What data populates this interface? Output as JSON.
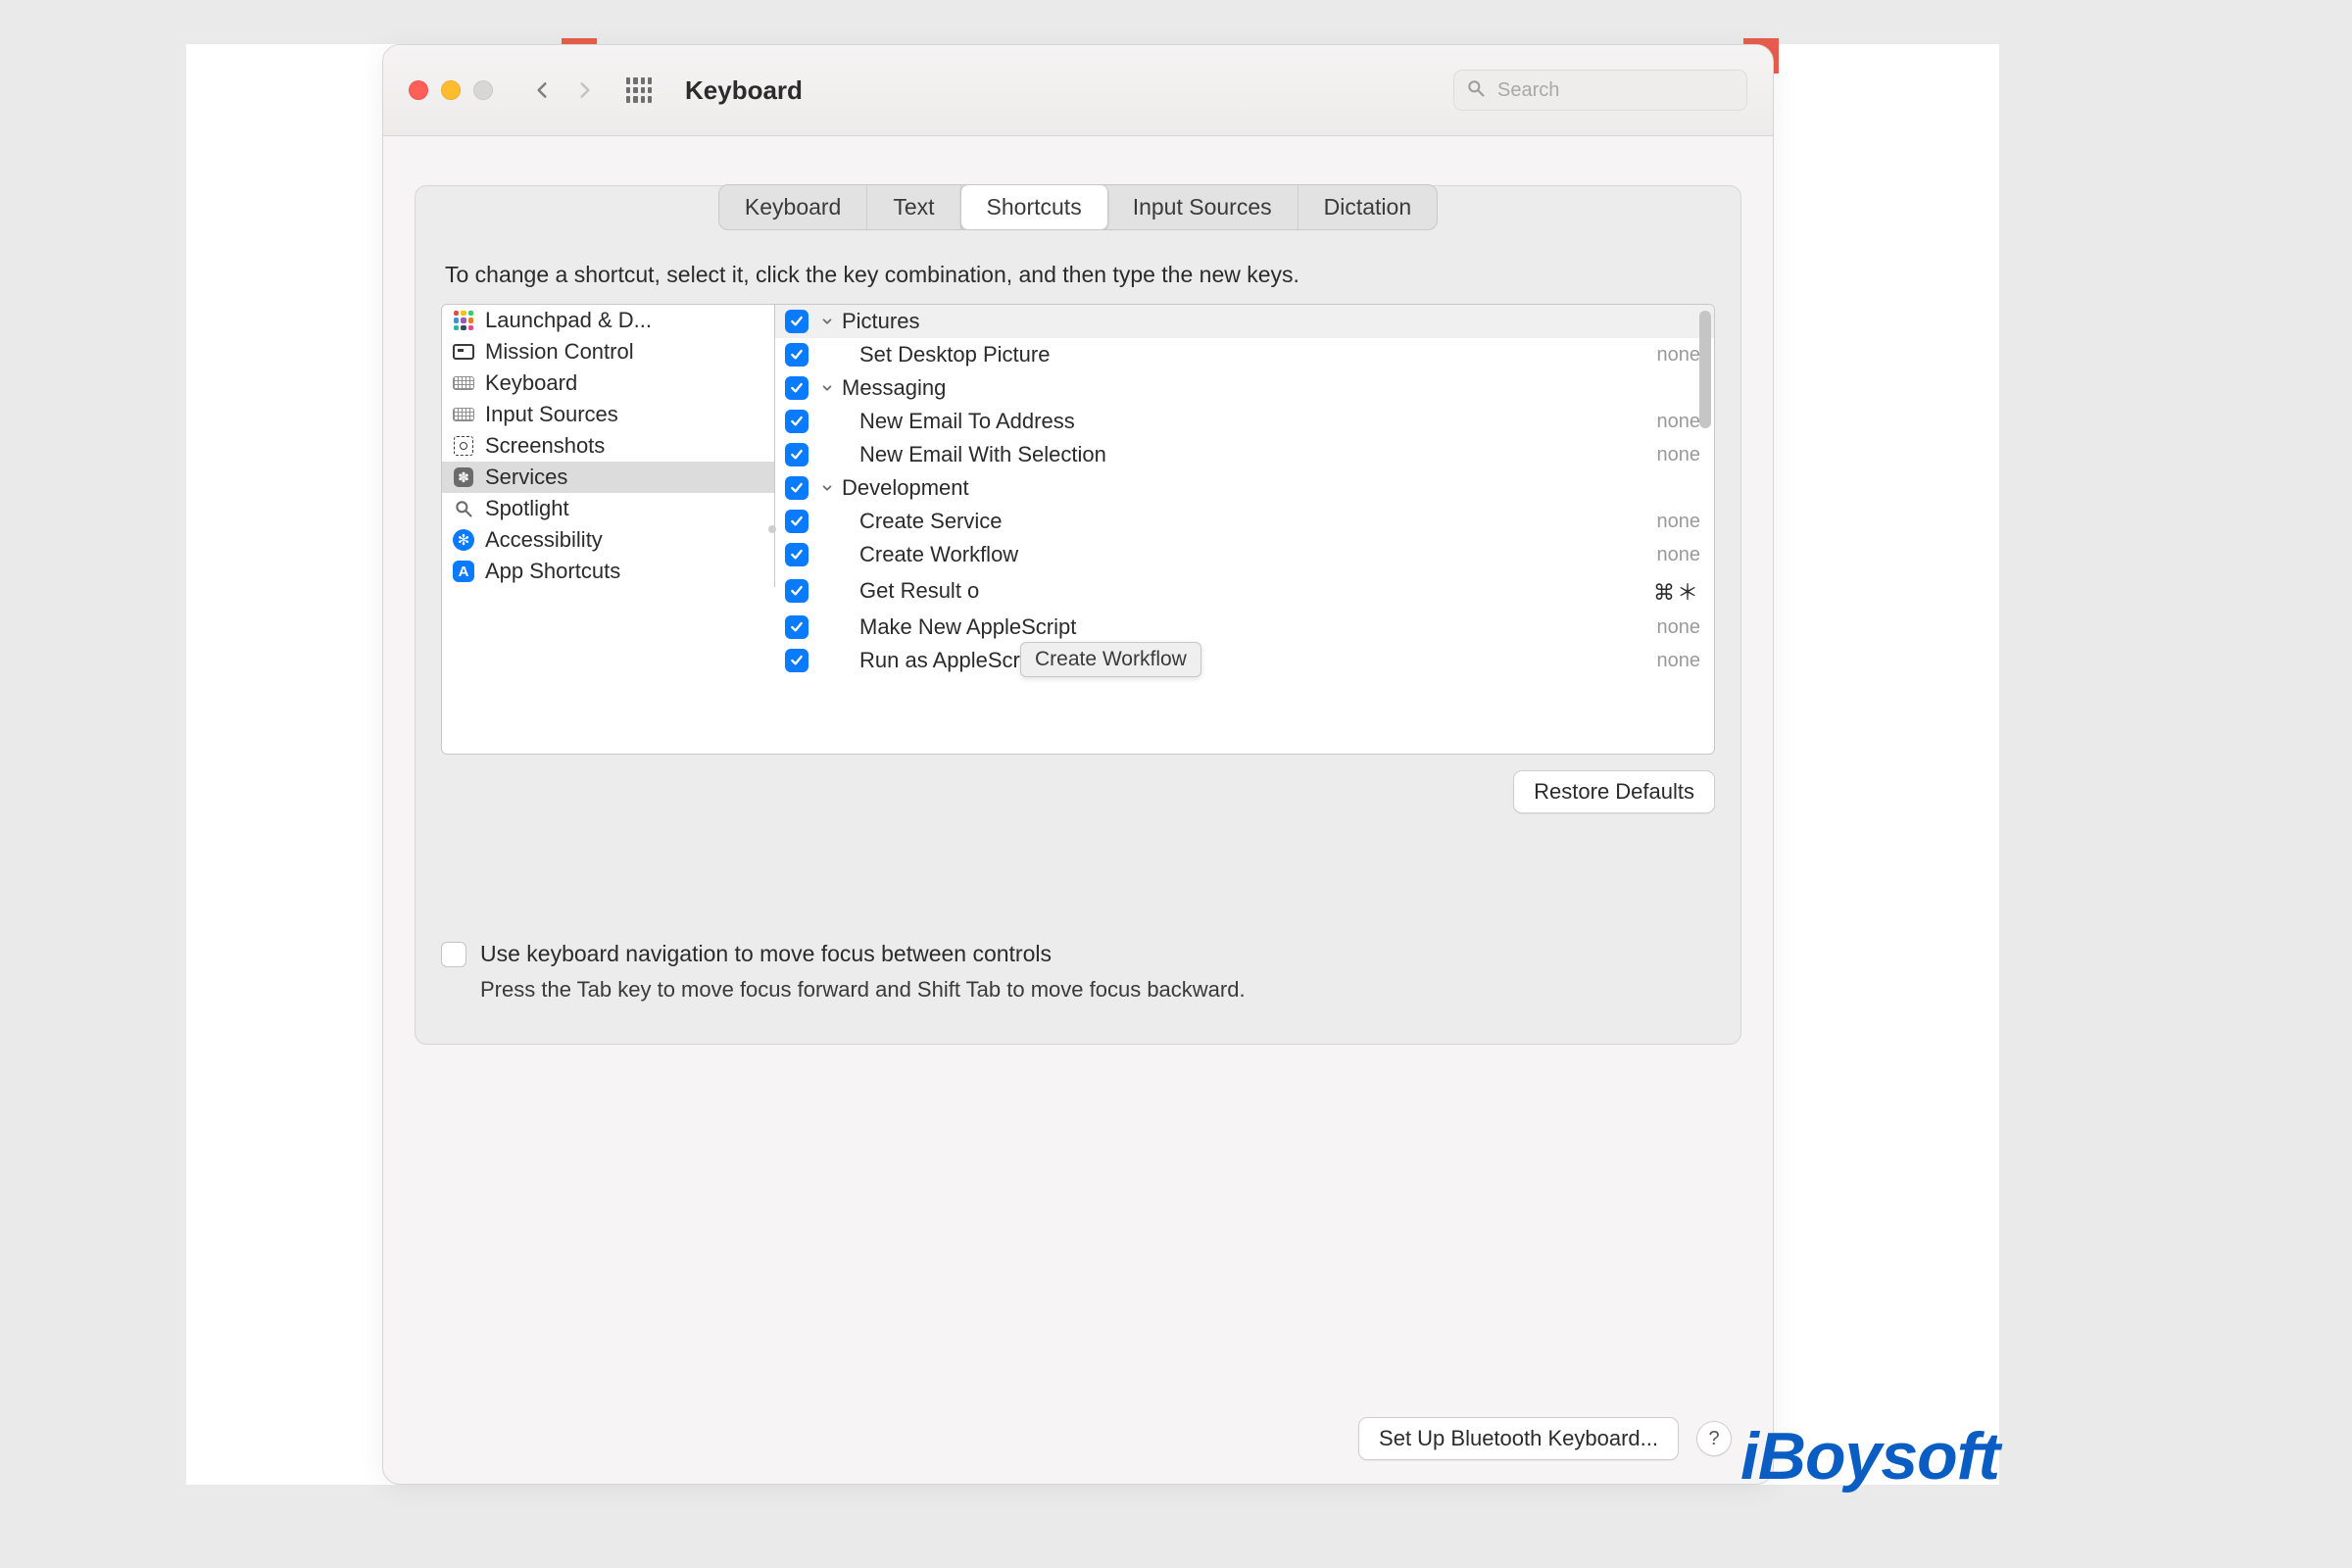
{
  "window": {
    "title": "Keyboard",
    "search_placeholder": "Search"
  },
  "tabs": [
    {
      "label": "Keyboard",
      "active": false
    },
    {
      "label": "Text",
      "active": false
    },
    {
      "label": "Shortcuts",
      "active": true
    },
    {
      "label": "Input Sources",
      "active": false
    },
    {
      "label": "Dictation",
      "active": false
    }
  ],
  "instruction": "To change a shortcut, select it, click the key combination, and then type the new keys.",
  "categories": [
    {
      "icon": "launchpad",
      "label": "Launchpad & D...",
      "selected": false
    },
    {
      "icon": "mission",
      "label": "Mission Control",
      "selected": false
    },
    {
      "icon": "keyboard",
      "label": "Keyboard",
      "selected": false
    },
    {
      "icon": "input",
      "label": "Input Sources",
      "selected": false
    },
    {
      "icon": "screenshot",
      "label": "Screenshots",
      "selected": false
    },
    {
      "icon": "gear",
      "label": "Services",
      "selected": true
    },
    {
      "icon": "spotlight",
      "label": "Spotlight",
      "selected": false
    },
    {
      "icon": "acc",
      "label": "Accessibility",
      "selected": false
    },
    {
      "icon": "app",
      "label": "App Shortcuts",
      "selected": false
    }
  ],
  "services": [
    {
      "type": "group",
      "checked": true,
      "label": "Pictures",
      "highlight": true
    },
    {
      "type": "item",
      "checked": true,
      "label": "Set Desktop Picture",
      "shortcut": "none"
    },
    {
      "type": "group",
      "checked": true,
      "label": "Messaging"
    },
    {
      "type": "item",
      "checked": true,
      "label": "New Email To Address",
      "shortcut": "none"
    },
    {
      "type": "item",
      "checked": true,
      "label": "New Email With Selection",
      "shortcut": "none"
    },
    {
      "type": "group",
      "checked": true,
      "label": "Development"
    },
    {
      "type": "item",
      "checked": true,
      "label": "Create Service",
      "shortcut": "none"
    },
    {
      "type": "item",
      "checked": true,
      "label": "Create Workflow",
      "shortcut": "none"
    },
    {
      "type": "item",
      "checked": true,
      "label": "Get Result o",
      "shortcut": "⌘＊",
      "shortcut_class": "sym",
      "tooltip": "Create Workflow"
    },
    {
      "type": "item",
      "checked": true,
      "label": "Make New AppleScript",
      "shortcut": "none"
    },
    {
      "type": "item",
      "checked": true,
      "label": "Run as AppleScript",
      "shortcut": "none"
    }
  ],
  "restore_label": "Restore Defaults",
  "kb_nav": {
    "label": "Use keyboard navigation to move focus between controls",
    "hint": "Press the Tab key to move focus forward and Shift Tab to move focus backward."
  },
  "footer": {
    "bluetooth": "Set Up Bluetooth Keyboard...",
    "help": "?"
  },
  "watermark": "iBoysoft"
}
